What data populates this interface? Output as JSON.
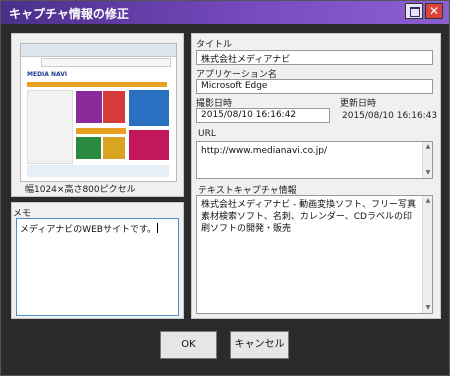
{
  "window": {
    "title": "キャプチャ情報の修正"
  },
  "thumbnail": {
    "size_label": "幅1024×高さ800ピクセル",
    "site_logo": "MEDIA NAVI"
  },
  "memo": {
    "label": "メモ",
    "value": "メディアナビのWEBサイトです。"
  },
  "fields": {
    "title": {
      "label": "タイトル",
      "value": "株式会社メディアナビ"
    },
    "application": {
      "label": "アプリケーション名",
      "value": "Microsoft Edge"
    },
    "captured": {
      "label": "撮影日時",
      "value": "2015/08/10 16:16:42"
    },
    "updated": {
      "label": "更新日時",
      "value": "2015/08/10 16:16:43"
    },
    "url": {
      "label": "URL",
      "value": "http://www.medianavi.co.jp/"
    },
    "text_capture": {
      "label": "テキストキャプチャ情報",
      "value": "株式会社メディアナビ - 動画変換ソフト、フリー写真素材検索ソフト、名刺、カレンダー、CDラベルの印刷ソフトの開発・販売"
    }
  },
  "buttons": {
    "ok": "OK",
    "cancel": "キャンセル"
  }
}
